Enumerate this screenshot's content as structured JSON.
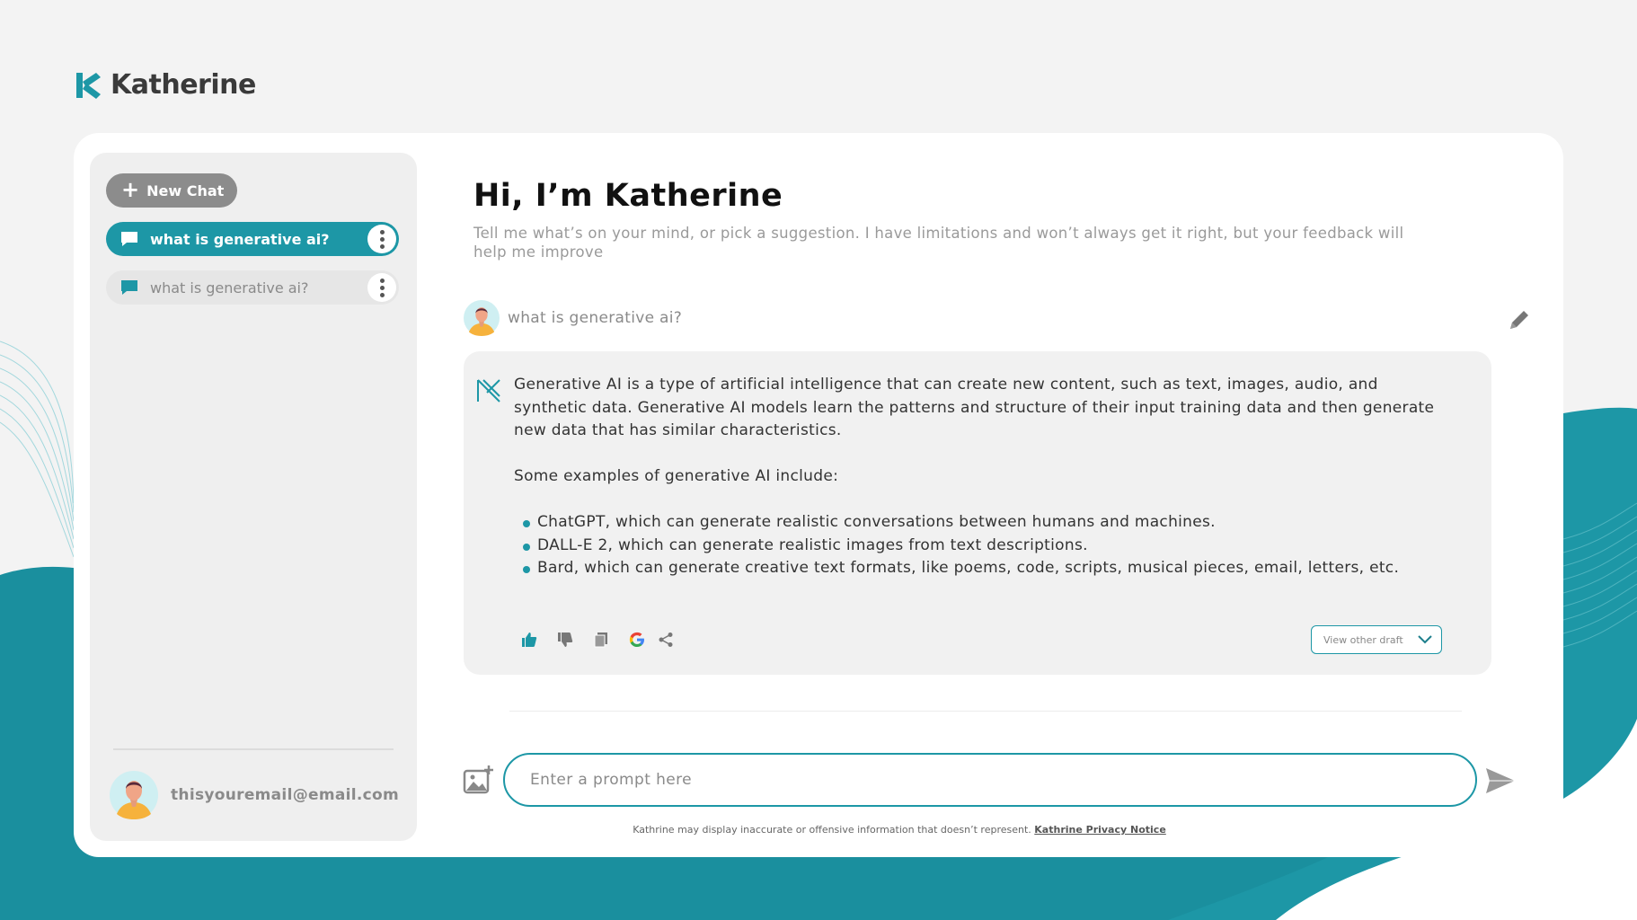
{
  "brand": {
    "name": "Katherine",
    "accent_color": "#1d97a6",
    "logo_icon": "katherine-logo-icon"
  },
  "sidebar": {
    "new_chat_label": "New Chat",
    "chats": [
      {
        "label": "what is generative ai?",
        "active": true,
        "icon": "message-icon"
      },
      {
        "label": "what is generative ai?",
        "active": false,
        "icon": "message-icon"
      }
    ],
    "user": {
      "email": "thisyouremail@email.com",
      "avatar": "user-avatar"
    }
  },
  "main": {
    "title": "Hi, I’m Katherine",
    "subtitle": "Tell me what’s on your mind, or pick a suggestion. I have limitations and won’t always get it right, but your feedback will help me improve",
    "question": "what is generative ai?",
    "answer": {
      "paragraph1": "Generative AI is a type of artificial intelligence that can create new content, such as text, images, audio, and synthetic data. Generative AI models learn the patterns and structure of their input training data and then generate new data that has similar characteristics.",
      "paragraph2": "Some examples of generative AI include:",
      "bullets": [
        "ChatGPT, which can generate realistic conversations between humans and machines.",
        "DALL-E 2, which can generate realistic images from text descriptions.",
        "Bard, which can generate creative text formats, like poems, code, scripts, musical pieces, email, letters, etc."
      ],
      "view_other_draft": "View other draft"
    },
    "prompt": {
      "placeholder": "Enter a prompt here"
    },
    "disclaimer": "Kathrine may display inaccurate or offensive information that doesn’t represent.",
    "privacy_link": "Kathrine Privacy Notice"
  }
}
